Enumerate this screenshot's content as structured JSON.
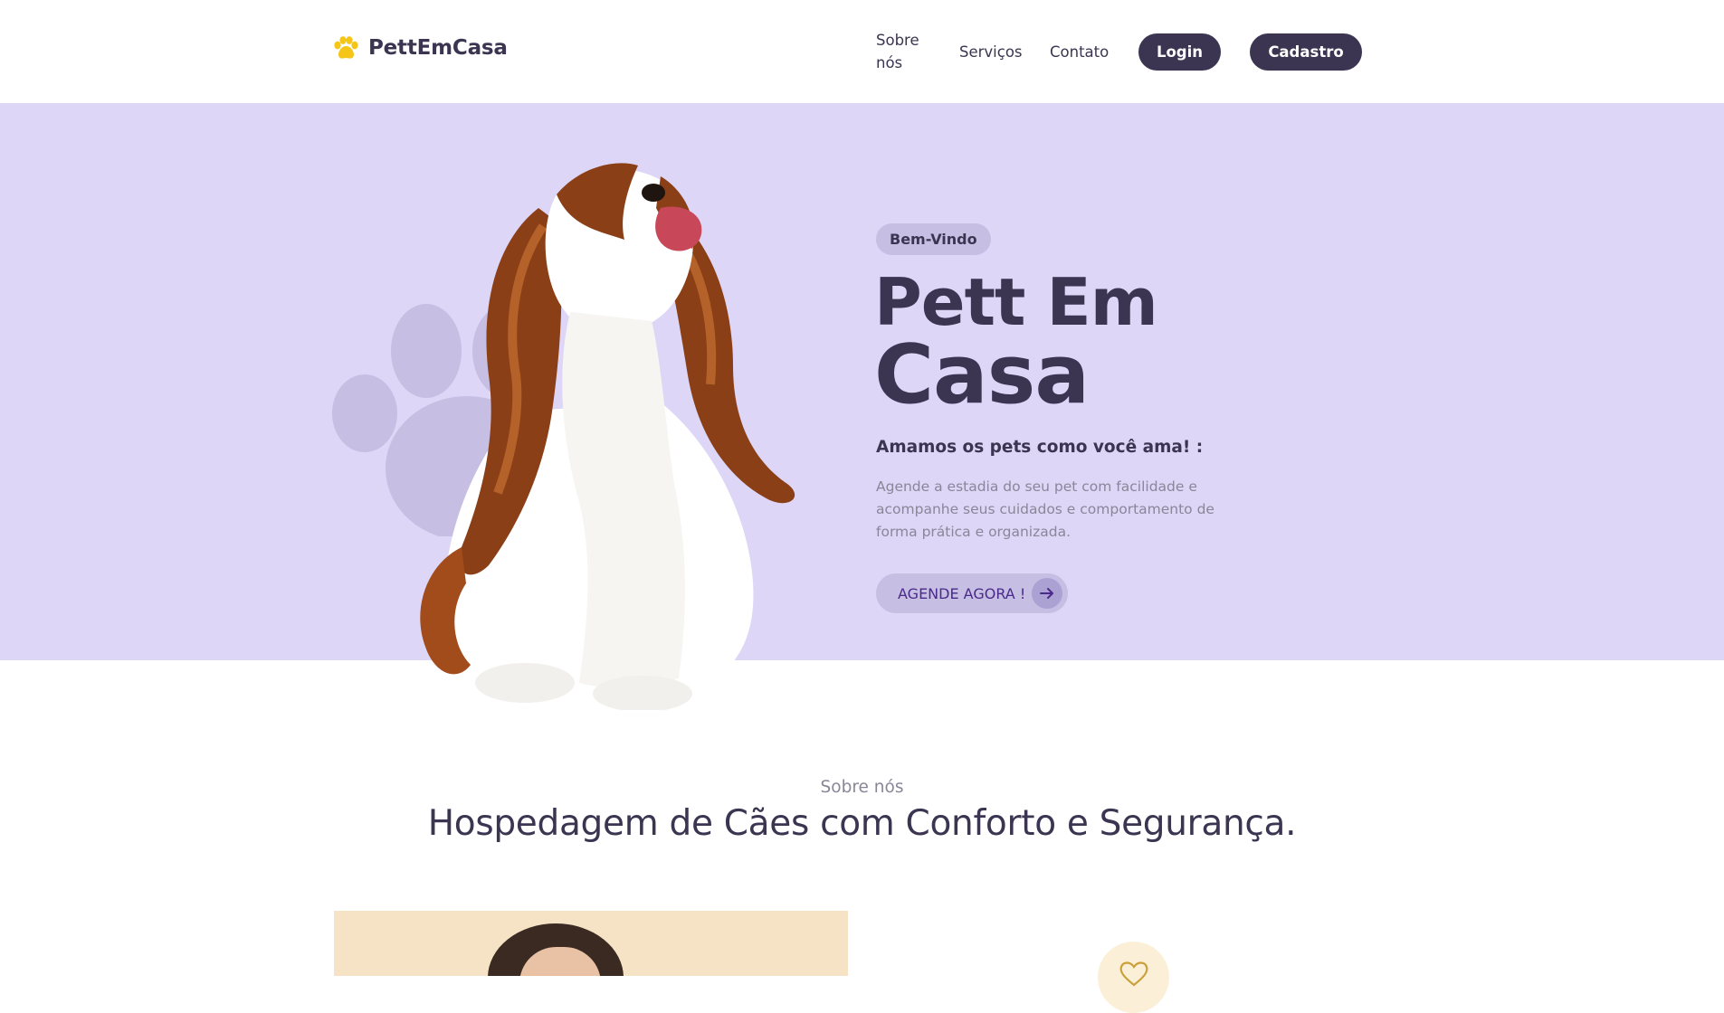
{
  "brand": {
    "name": "PettEmCasa",
    "icon": "paw-icon",
    "icon_color": "#f5c518"
  },
  "nav": {
    "items": [
      {
        "label": "Sobre nós"
      },
      {
        "label": "Serviços"
      },
      {
        "label": "Contato"
      }
    ],
    "login_label": "Login",
    "signup_label": "Cadastro"
  },
  "hero": {
    "badge": "Bem-Vindo",
    "title_line1": "Pett Em",
    "title_line2": "Casa",
    "subtitle": "Amamos os pets como você ama! :",
    "description": "Agende a estadia do seu pet com facilidade e acompanhe seus cuidados e comportamento de forma prática e organizada.",
    "cta_label": "AGENDE AGORA !",
    "cta_icon": "arrow-right-icon",
    "background_color": "#ddd6f7"
  },
  "about": {
    "eyebrow": "Sobre nós",
    "title": "Hospedagem de Cães com Conforto e Segurança."
  },
  "colors": {
    "primary": "#3b3551",
    "accent_paw": "#f5c518",
    "muted_text": "#8a8699"
  }
}
